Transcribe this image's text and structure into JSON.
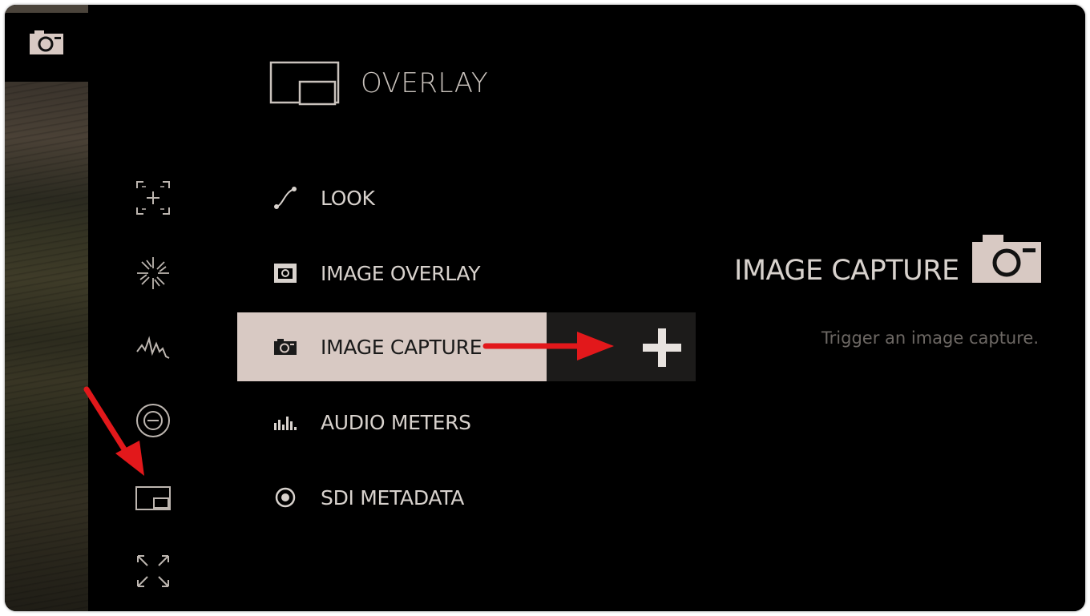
{
  "header": {
    "title": "OVERLAY",
    "icon": "overlay-icon"
  },
  "sidebar": {
    "items": [
      {
        "name": "focus-assist-icon"
      },
      {
        "name": "exposure-icon"
      },
      {
        "name": "waveform-icon"
      },
      {
        "name": "exposure-comp-icon"
      },
      {
        "name": "overlay-icon",
        "active": true
      },
      {
        "name": "fullscreen-icon"
      }
    ]
  },
  "menu": {
    "items": [
      {
        "label": "LOOK",
        "icon": "curve-icon"
      },
      {
        "label": "IMAGE OVERLAY",
        "icon": "image-overlay-icon"
      },
      {
        "label": "IMAGE CAPTURE",
        "icon": "camera-icon",
        "selected": true
      },
      {
        "label": "AUDIO METERS",
        "icon": "audio-meters-icon"
      },
      {
        "label": "SDI METADATA",
        "icon": "sdi-metadata-icon"
      }
    ]
  },
  "add_button": {
    "symbol": "+"
  },
  "detail": {
    "title": "IMAGE CAPTURE",
    "icon": "camera-icon",
    "description": "Trigger an image capture."
  },
  "colors": {
    "selected_bg": "#d8c9c3",
    "annotation_arrow": "#e2181b",
    "text": "#d8d2cd"
  }
}
